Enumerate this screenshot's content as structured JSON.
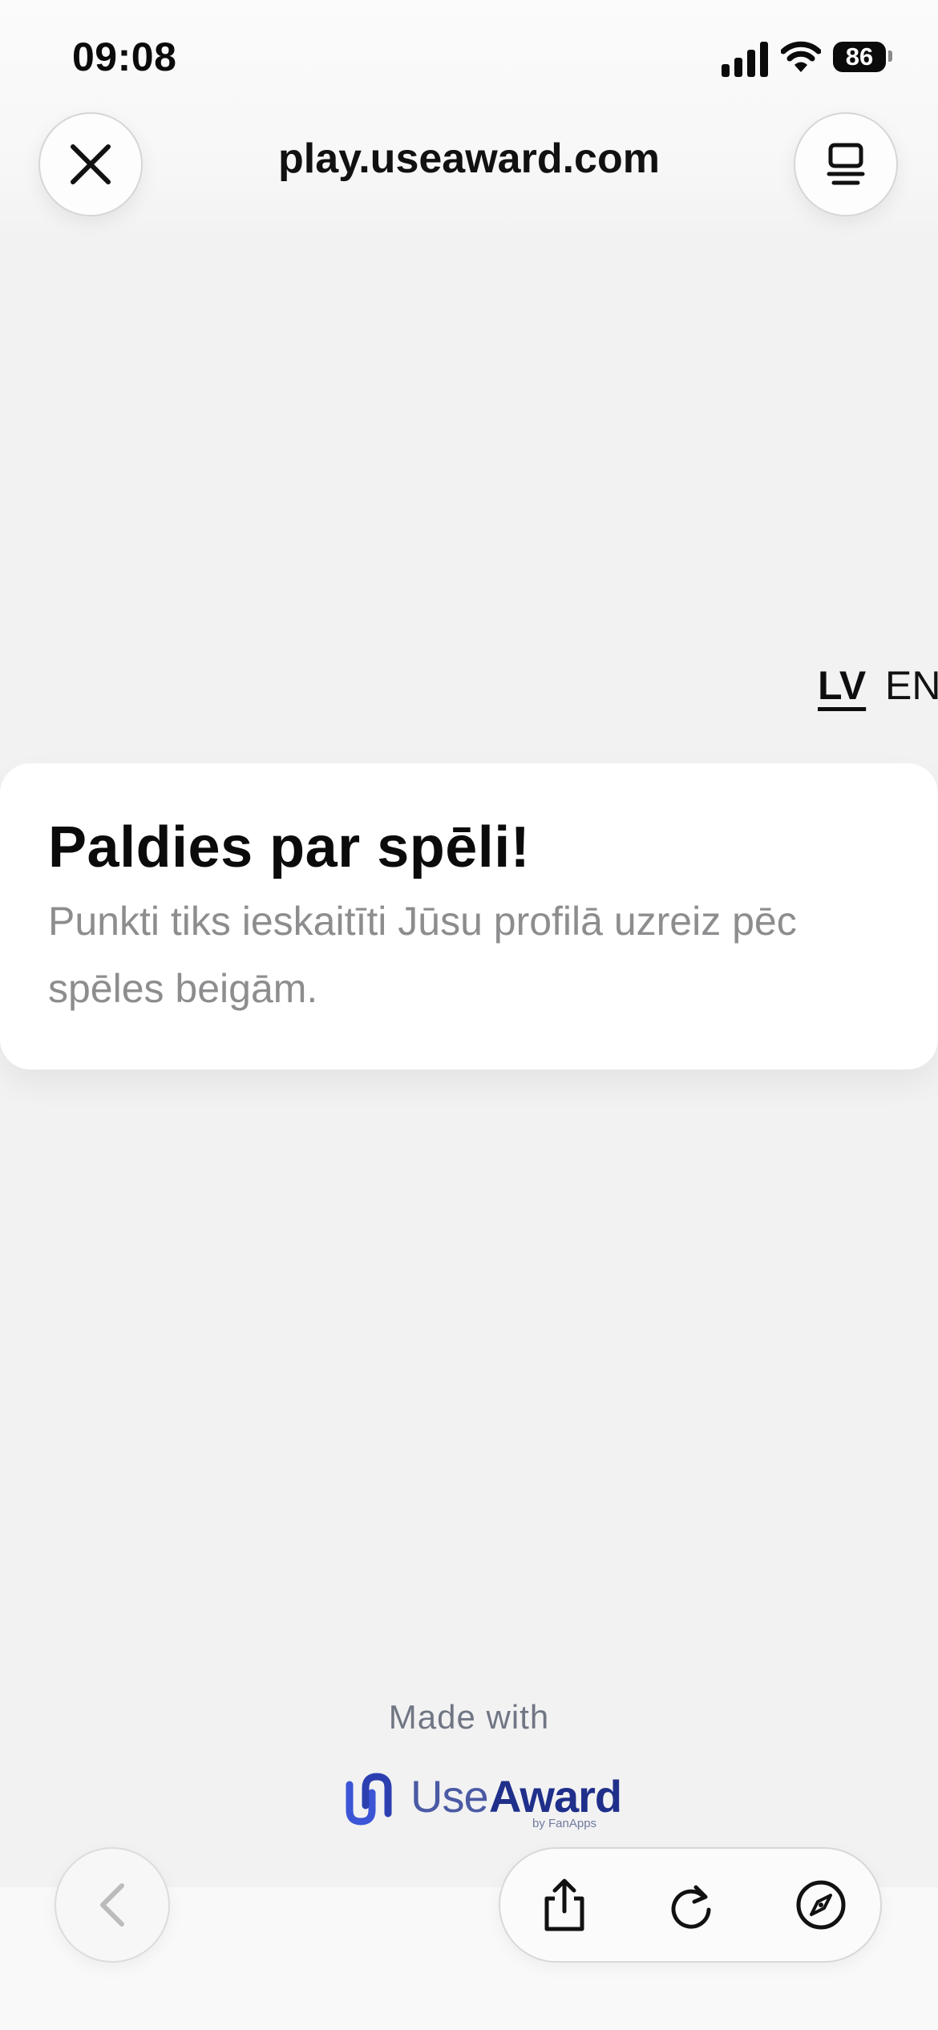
{
  "status_bar": {
    "time": "09:08",
    "battery": "86",
    "icons": [
      "cellular-signal-icon",
      "wifi-icon",
      "battery-icon"
    ]
  },
  "browser": {
    "url": "play.useaward.com",
    "close_icon": "close-icon",
    "tabs_icon": "tab-overview-icon"
  },
  "language": {
    "options": [
      "LV",
      "EN"
    ],
    "selected": "LV"
  },
  "card": {
    "title": "Paldies par spēli!",
    "text": "Punkti tiks ieskaitīti Jūsu profilā uzreiz pēc spēles beigām."
  },
  "footer": {
    "made_with": "Made with",
    "brand_use": "Use",
    "brand_award": "Award",
    "brand_by": "by FanApps",
    "brand_colors": {
      "dark": "#1f2f8a",
      "light": "#4a5aa3",
      "mark": "#3b55d6"
    }
  },
  "bottom_bar": {
    "icons": [
      "back-chevron-icon",
      "share-icon",
      "reload-icon",
      "compass-icon"
    ]
  }
}
